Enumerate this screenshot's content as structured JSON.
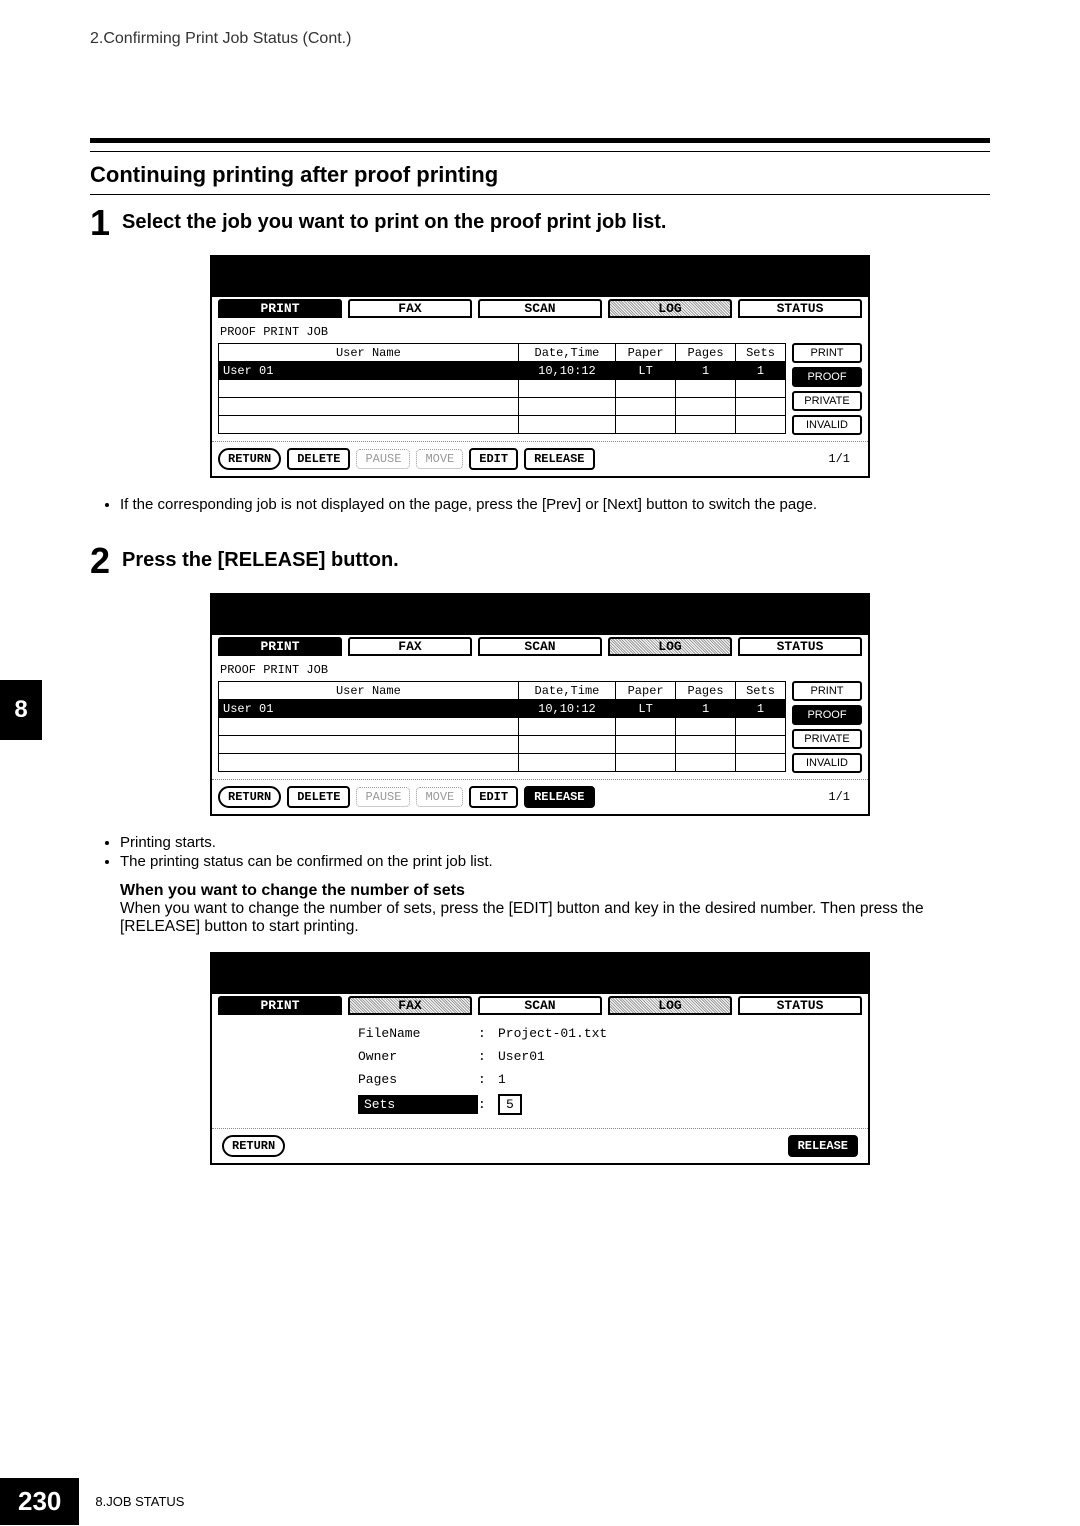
{
  "header": "2.Confirming Print Job Status (Cont.)",
  "section_title": "Continuing printing after proof printing",
  "step1": {
    "num": "1",
    "text": "Select the job you want to print on the proof print job list."
  },
  "step2": {
    "num": "2",
    "text": "Press the [RELEASE] button."
  },
  "tabs": {
    "print": "PRINT",
    "fax": "FAX",
    "scan": "SCAN",
    "log": "LOG",
    "status": "STATUS"
  },
  "sidebtns": {
    "print": "PRINT",
    "proof": "PROOF",
    "private": "PRIVATE",
    "invalid": "INVALID"
  },
  "list_subtitle": "PROOF PRINT JOB",
  "headers": {
    "user": "User Name",
    "dt": "Date,Time",
    "paper": "Paper",
    "pages": "Pages",
    "sets": "Sets"
  },
  "row1": {
    "user": "User 01",
    "dt": "10,10:12",
    "paper": "LT",
    "pages": "1",
    "sets": "1"
  },
  "bbtns": {
    "return": "RETURN",
    "delete": "DELETE",
    "pause": "PAUSE",
    "move": "MOVE",
    "edit": "EDIT",
    "release": "RELEASE"
  },
  "page_frac": "1/1",
  "note1": "If the corresponding job is not displayed on the page, press the [Prev] or [Next] button to switch the page.",
  "notes2": {
    "a": "Printing starts.",
    "b": "The printing status can be confirmed on the print job list."
  },
  "subheading": "When you want to change the number of sets",
  "para": "When you want to change the number of sets, press the [EDIT] button and key in the desired number. Then press the [RELEASE] button to start printing.",
  "edit": {
    "labels": {
      "filename": "FileName",
      "owner": "Owner",
      "pages": "Pages",
      "sets": "Sets"
    },
    "values": {
      "filename": "Project-01.txt",
      "owner": "User01",
      "pages": "1",
      "sets": "5"
    },
    "colon": ":"
  },
  "chapter_tab": "8",
  "footer": {
    "page": "230",
    "text": "8.JOB STATUS"
  }
}
